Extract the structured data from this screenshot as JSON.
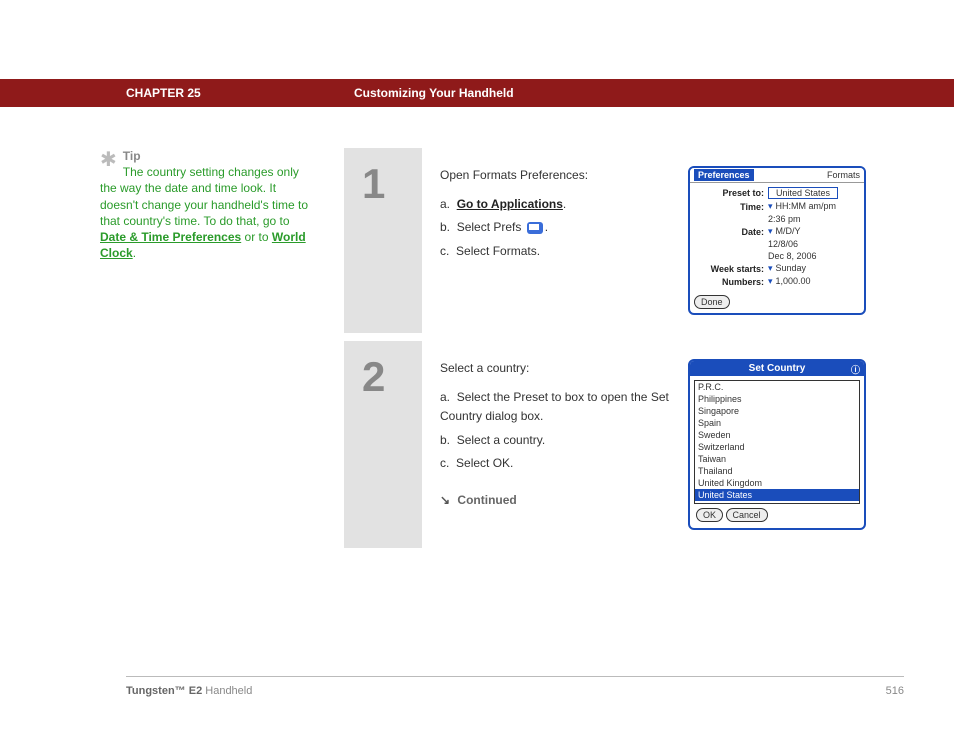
{
  "header": {
    "chapter": "CHAPTER 25",
    "title": "Customizing Your Handheld"
  },
  "sidebar": {
    "tip_label": "Tip",
    "tip_before": "The country setting changes only the way the date and time look. It doesn't change your handheld's time to that country's time. To do that, go to ",
    "link1": "Date & Time Preferences",
    "mid": " or to ",
    "link2": "World Clock",
    "after": "."
  },
  "steps": [
    {
      "num": "1",
      "lead": "Open Formats Preferences:",
      "items": [
        {
          "prefix": "a.",
          "kind": "link",
          "text": "Go to Applications",
          "suffix": "."
        },
        {
          "prefix": "b.",
          "kind": "icon",
          "text": "Select Prefs ",
          "suffix": "."
        },
        {
          "prefix": "c.",
          "kind": "plain",
          "text": "Select Formats."
        }
      ]
    },
    {
      "num": "2",
      "lead": "Select a country:",
      "items": [
        {
          "prefix": "a.",
          "kind": "plain",
          "text": "Select the Preset to box to open the Set Country dialog box."
        },
        {
          "prefix": "b.",
          "kind": "plain",
          "text": "Select a country."
        },
        {
          "prefix": "c.",
          "kind": "plain",
          "text": "Select OK."
        }
      ],
      "continued": "Continued"
    }
  ],
  "shot1": {
    "prefs_tab": "Preferences",
    "right_tab": "Formats",
    "preset_label": "Preset to:",
    "preset_value": "United States",
    "rows": [
      {
        "label": "Time:",
        "value": "HH:MM am/pm",
        "sub": "2:36 pm",
        "drop": true
      },
      {
        "label": "Date:",
        "value": "M/D/Y",
        "sub": "12/8/06",
        "sub2": "Dec 8, 2006",
        "drop": true
      },
      {
        "label": "Week starts:",
        "value": "Sunday",
        "drop": true
      },
      {
        "label": "Numbers:",
        "value": "1,000.00",
        "drop": true
      }
    ],
    "done": "Done"
  },
  "shot2": {
    "title": "Set Country",
    "info": "ⓘ",
    "list": [
      "P.R.C.",
      "Philippines",
      "Singapore",
      "Spain",
      "Sweden",
      "Switzerland",
      "Taiwan",
      "Thailand",
      "United Kingdom",
      "United States"
    ],
    "selected": "United States",
    "ok": "OK",
    "cancel": "Cancel"
  },
  "footer": {
    "product_bold": "Tungsten™ E2",
    "product_rest": " Handheld",
    "page": "516"
  }
}
